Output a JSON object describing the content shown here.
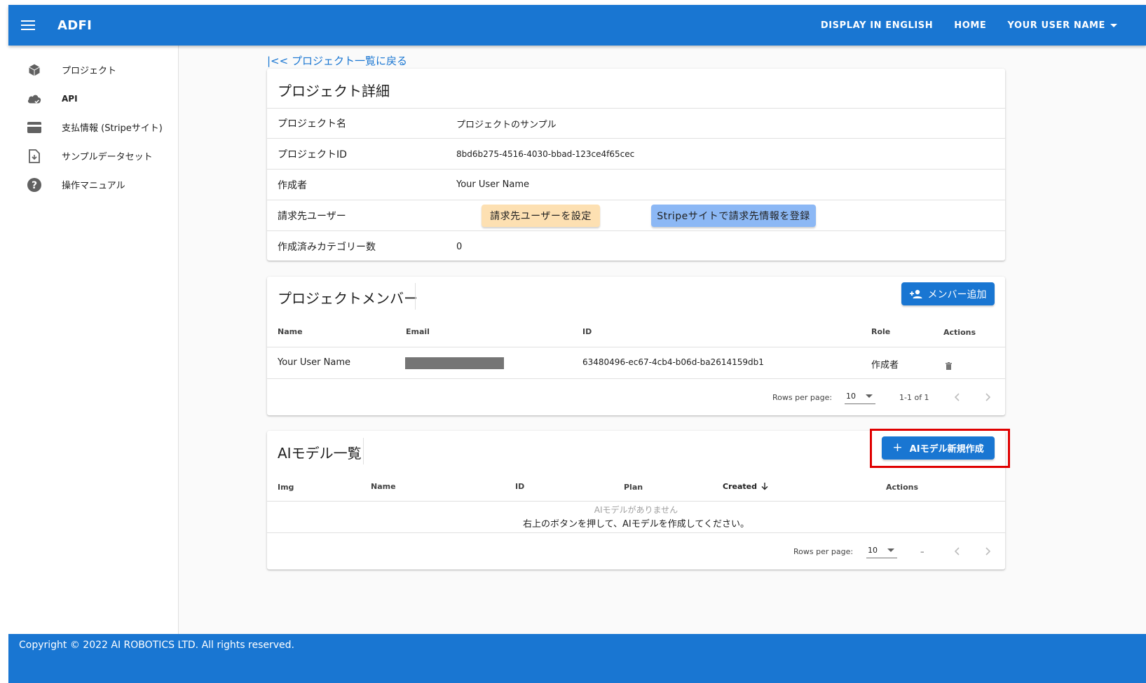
{
  "app": {
    "title": "ADFI"
  },
  "header": {
    "display_english": "DISPLAY IN ENGLISH",
    "home": "HOME",
    "user": "YOUR USER NAME"
  },
  "sidebar": {
    "items": [
      {
        "label": "プロジェクト",
        "icon": "cube-icon"
      },
      {
        "label": "API",
        "icon": "cloud-check-icon"
      },
      {
        "label": "支払情報 (Stripeサイト)",
        "icon": "credit-card-icon"
      },
      {
        "label": "サンプルデータセット",
        "icon": "file-download-icon"
      },
      {
        "label": "操作マニュアル",
        "icon": "help-circle-icon"
      }
    ]
  },
  "back_link": "|<< プロジェクト一覧に戻る",
  "details": {
    "title": "プロジェクト詳細",
    "rows": [
      {
        "label": "プロジェクト名",
        "value": "プロジェクトのサンプル"
      },
      {
        "label": "プロジェクトID",
        "value": "8bd6b275-4516-4030-bbad-123ce4f65cec"
      },
      {
        "label": "作成者",
        "value": "Your User Name"
      },
      {
        "label": "請求先ユーザー",
        "value": ""
      },
      {
        "label": "作成済みカテゴリー数",
        "value": "0"
      }
    ],
    "set_billing_user_button": "請求先ユーザーを設定",
    "stripe_register_button": "Stripeサイトで請求先情報を登録"
  },
  "members": {
    "title": "プロジェクトメンバー",
    "add_button": "メンバー追加",
    "columns": [
      "Name",
      "Email",
      "ID",
      "Role",
      "Actions"
    ],
    "rows": [
      {
        "name": "Your User Name",
        "id": "63480496-ec67-4cb4-b06d-ba2614159db1",
        "role": "作成者"
      }
    ],
    "pager": {
      "rows_per_page_label": "Rows per page:",
      "rows_per_page": "10",
      "range": "1-1 of 1"
    }
  },
  "models": {
    "title": "AIモデル一覧",
    "create_button": "AIモデル新規作成",
    "columns": [
      "Img",
      "Name",
      "ID",
      "Plan",
      "Created",
      "Actions"
    ],
    "empty_line1": "AIモデルがありません",
    "empty_line2": "右上のボタンを押して、AIモデルを作成してください。",
    "pager": {
      "rows_per_page_label": "Rows per page:",
      "rows_per_page": "10",
      "range": "–"
    }
  },
  "footer": {
    "text": "Copyright © 2022 AI ROBOTICS LTD. All rights reserved."
  },
  "colors": {
    "primary": "#1976d2",
    "peach": "#fde0b2",
    "light_blue": "#8cb8f5",
    "highlight": "#e00000"
  }
}
